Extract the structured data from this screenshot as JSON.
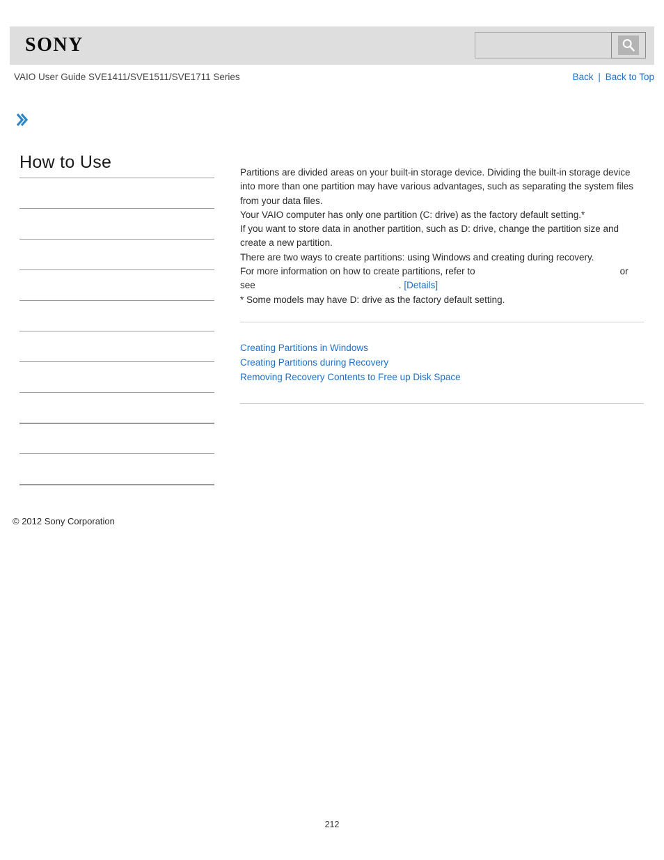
{
  "header": {
    "logo_text": "SONY",
    "search": {
      "value": "",
      "placeholder": "",
      "button_icon": "search-icon"
    }
  },
  "subheader": {
    "guide_title": "VAIO User Guide SVE1411/SVE1511/SVE1711 Series",
    "back_label": "Back",
    "separator": "|",
    "back_to_top_label": "Back to Top"
  },
  "breadcrumb": {
    "arrow_icon": "chevron-right-icon",
    "arrow_glyph": "❯",
    "items": []
  },
  "sidebar": {
    "title": "How to Use",
    "items": [
      {
        "label": ""
      },
      {
        "label": ""
      },
      {
        "label": ""
      },
      {
        "label": ""
      },
      {
        "label": ""
      },
      {
        "label": ""
      },
      {
        "label": ""
      },
      {
        "label": ""
      },
      {
        "label": ""
      },
      {
        "label": ""
      },
      {
        "label": ""
      }
    ]
  },
  "main": {
    "paragraphs": [
      "Partitions are divided areas on your built-in storage device. Dividing the built-in storage device into more than one partition may have various advantages, such as separating the system files from your data files.",
      "Your VAIO computer has only one partition (C: drive) as the factory default setting.*",
      "If you want to store data in another partition, such as D: drive, change the partition size and create a new partition.",
      "There are two ways to create partitions: using Windows and creating during recovery."
    ],
    "refer_line_prefix": "For more information on how to create partitions, refer to",
    "refer_line_link": "",
    "refer_line_suffix": "or",
    "see_line_prefix": "see",
    "see_line_link": "",
    "see_line_period": ".",
    "details_label": "[Details]",
    "footnote": "* Some models may have D: drive as the factory default setting."
  },
  "related": {
    "links": [
      "Creating Partitions in Windows",
      "Creating Partitions during Recovery",
      "Removing Recovery Contents to Free up Disk Space"
    ]
  },
  "footer": {
    "copyright": "© 2012 Sony Corporation",
    "page_number": "212"
  },
  "colors": {
    "link": "#1c6fcc",
    "header_band": "#dedede",
    "rule": "#9b9b9b",
    "content_rule": "#cdcdcd",
    "accent_arrow": "#2e86c8"
  }
}
